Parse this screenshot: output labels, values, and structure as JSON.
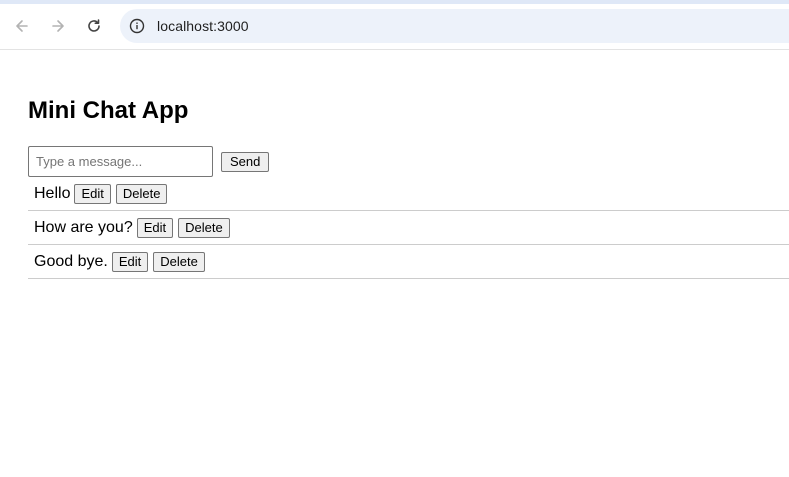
{
  "browser": {
    "url": "localhost:3000"
  },
  "app": {
    "title": "Mini Chat App",
    "input_placeholder": "Type a message...",
    "input_value": "",
    "send_label": "Send"
  },
  "messages": [
    {
      "text": "Hello",
      "edit_label": "Edit",
      "delete_label": "Delete"
    },
    {
      "text": "How are you?",
      "edit_label": "Edit",
      "delete_label": "Delete"
    },
    {
      "text": "Good bye.",
      "edit_label": "Edit",
      "delete_label": "Delete"
    }
  ],
  "icons": {
    "back": "arrow-left-icon",
    "forward": "arrow-right-icon",
    "reload": "reload-icon",
    "info": "info-icon"
  },
  "colors": {
    "address_bar_bg": "#edf2fa",
    "divider": "#cccccc",
    "button_bg": "#efefef"
  }
}
